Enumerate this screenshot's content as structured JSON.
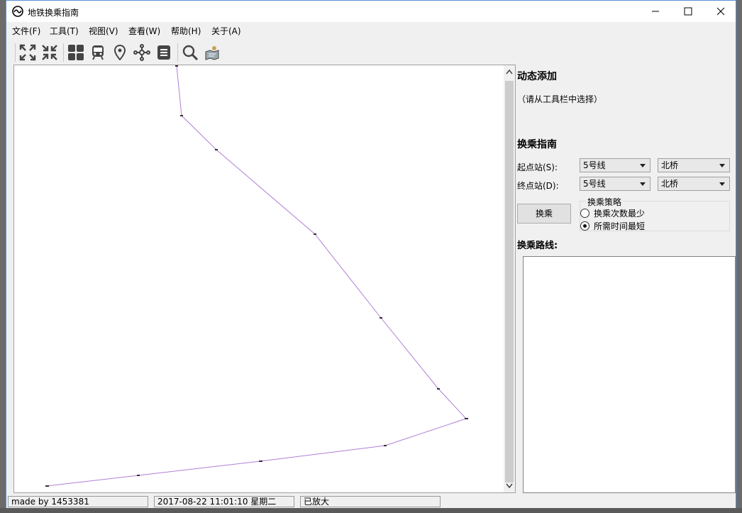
{
  "window": {
    "title": "地铁换乘指南"
  },
  "menu": [
    "文件(F)",
    "工具(T)",
    "视图(V)",
    "查看(W)",
    "帮助(H)",
    "关于(A)"
  ],
  "toolbar": [
    "expand-icon",
    "shrink-icon",
    "grid-icon",
    "train-icon",
    "location-pin-icon",
    "network-icon",
    "list-icon",
    "search-icon",
    "map-icon"
  ],
  "map": {
    "line_color": "#b07fd6"
  },
  "panel": {
    "dynamic_title": "动态添加",
    "dynamic_hint": "（请从工具栏中选择）",
    "transfer_title": "换乘指南",
    "start_label": "起点站(S):",
    "end_label": "终点站(D):",
    "start_line": "5号线",
    "start_station": "北桥",
    "end_line": "5号线",
    "end_station": "北桥",
    "go_button": "换乘",
    "strategy_title": "换乘策略",
    "strategy_opt1": "换乘次数最少",
    "strategy_opt2": "所需时间最短",
    "strategy_selected": "所需时间最短",
    "route_title": "换乘路线:"
  },
  "status": {
    "made_by": "made by 1453381",
    "datetime": "2017-08-22 11:01:10 星期二",
    "zoom": "已放大"
  }
}
